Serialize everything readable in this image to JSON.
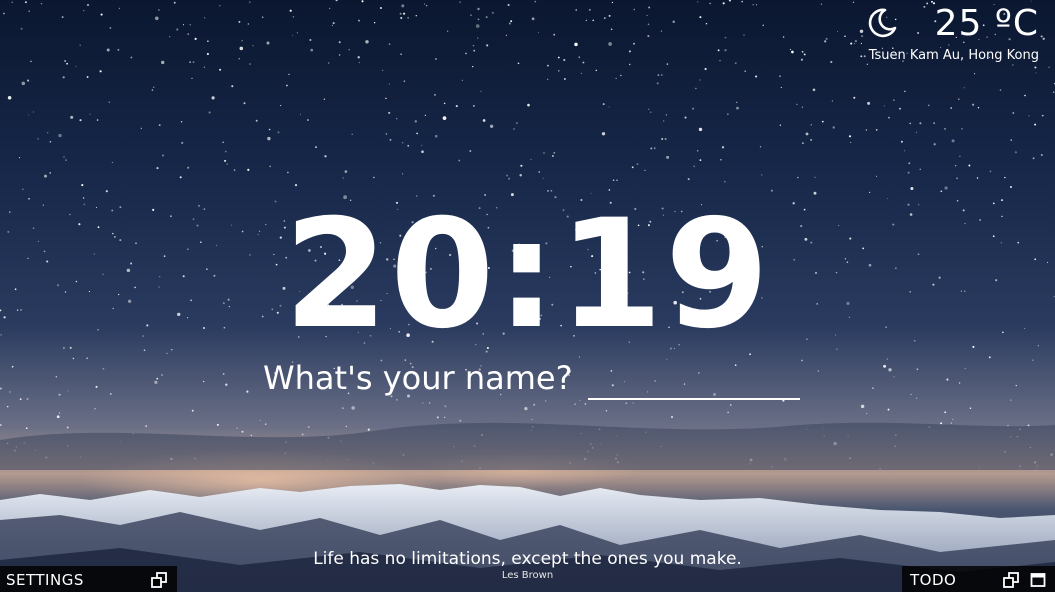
{
  "weather": {
    "icon": "moon-icon",
    "temperature": "25 ºC",
    "location": "Tsuen Kam Au, Hong Kong"
  },
  "clock": {
    "time": "20:19"
  },
  "greeting": {
    "question": "What's your name?",
    "input_value": ""
  },
  "quote": {
    "text": "Life has no limitations, except the ones you make.",
    "author": "Les Brown"
  },
  "settings_panel": {
    "label": "SETTINGS",
    "icons": [
      "popout-icon"
    ]
  },
  "todo_panel": {
    "label": "TODO",
    "icons": [
      "popout-icon",
      "maximize-icon"
    ]
  }
}
